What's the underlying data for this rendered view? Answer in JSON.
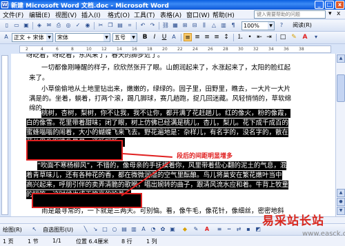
{
  "window": {
    "title": "新建 Microsoft Word 文档.doc - Microsoft Word",
    "minimize": "_",
    "maximize": "□",
    "close": "x"
  },
  "menu": {
    "items": [
      "文件(F)",
      "编辑(E)",
      "视图(V)",
      "插入(I)",
      "格式(O)",
      "工具(T)",
      "表格(A)",
      "窗口(W)",
      "帮助(H)"
    ],
    "help_placeholder": "键入需要帮助的问题"
  },
  "standard_toolbar": {
    "zoom": "100%",
    "read_label": "阅读(R)"
  },
  "format_toolbar": {
    "style": "正文 + 宋体",
    "font": "宋体",
    "size": "五号",
    "bold": "B",
    "italic": "I",
    "underline": "U",
    "font_color_label": "A"
  },
  "ruler": {
    "ticks": [
      "2",
      "4",
      "6",
      "8",
      "10",
      "12",
      "14",
      "16",
      "18",
      "20",
      "22",
      "24",
      "26",
      "28",
      "30",
      "32",
      "34",
      "36",
      "38"
    ]
  },
  "document": {
    "lines": [
      "呀眨着，呀眨着，东风来了，春天的脚步近了。",
      "一切都像刚睡醒的样子，欣欣然张开了眼。山朗润起来了，水涨起来了，太阳的脸红起",
      "来了。",
      "小草偷偷地从土地里钻出来，嫩嫩的，绿绿的。园子里，田野里，瞧去，一大片一大片",
      "满是的。坐着，躺着，打两个滚，踢几脚球，赛几趟跑，捉几回迷藏。风轻悄悄的，草软绵",
      "绵的。",
      "桃树，杏树，梨树，你不让我，我不让你，都开满了花赶趟儿。红的像火，粉的像霞，",
      "白的像雪。花里带着甜味；闭了眼，树上仿佛已经满是桃儿，杏儿，梨儿。花下成千成百的",
      "蜜蜂嗡嗡的闹着，大小的蝴蝶飞来飞去。野花遍地是：杂样儿，有名字的，没名字的，散在",
      "草丛里像眼睛像星星，还眨呀眨。",
      "“吹面不寒杨柳风”，不错的，像母亲的手抚摸着你，风里带着些心翻的泥土的气息，混",
      "着青草味儿，还有各种花的香，都在微微润湿的空气里酝酿。鸟儿将巢安在繁花嫩叶当中",
      "高兴起来，呼朋引伴的卖弄清脆的歌喉，唱出婉转的曲子，跟清风流水应和着。牛背上牧童",
      "的短笛，这时候也成天嘹亮的响着。",
      "雨是最寻常的，一下就是三两天。可别恼。看，像牛毛，像花针，像细丝，密密地斜"
    ],
    "annotation": "段后的间距明显增多"
  },
  "drawing_toolbar": {
    "draw_label": "绘图(R)",
    "autoshapes_label": "自选图形(U)"
  },
  "status": {
    "page": "1 页",
    "section": "1 节",
    "page_of": "1/1",
    "position": "位置 6.4厘米",
    "line": "8 行",
    "column": "1 列"
  },
  "watermark": {
    "text": "易采站长站",
    "url": "www.easck.com"
  },
  "colors": {
    "titlebar": "#0a5fe0",
    "annotation": "#e02020",
    "selection": "#000000"
  }
}
